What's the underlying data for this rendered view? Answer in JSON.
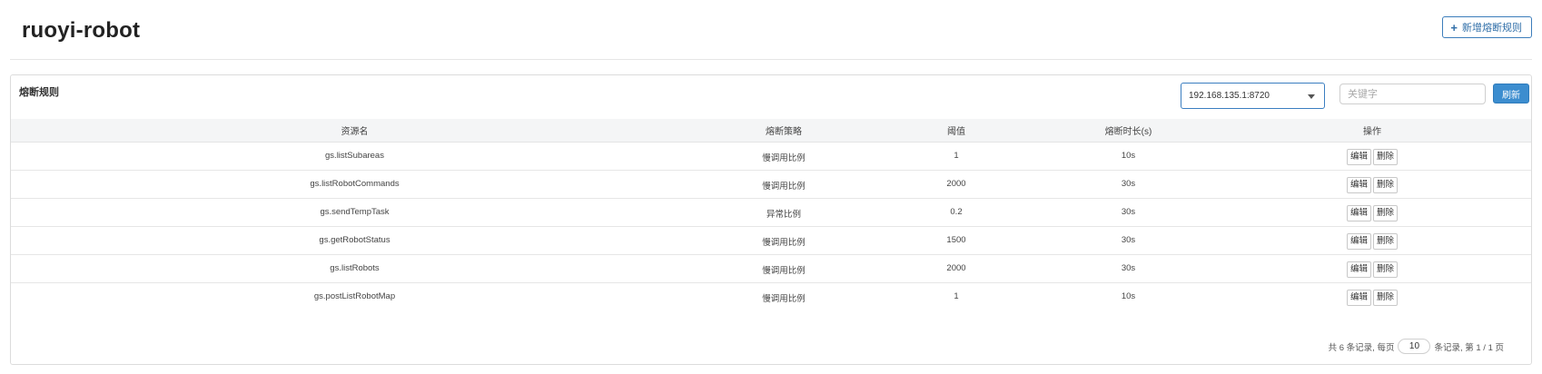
{
  "header": {
    "app_title": "ruoyi-robot",
    "add_button_label": "新增熔断规则"
  },
  "panel": {
    "title": "熔断规则",
    "machine_select": {
      "selected": "192.168.135.1:8720"
    },
    "search": {
      "placeholder": "关键字",
      "value": ""
    },
    "refresh_label": "刷新"
  },
  "table": {
    "columns": [
      "资源名",
      "熔断策略",
      "阈值",
      "熔断时长(s)",
      "操作"
    ],
    "rows": [
      {
        "resource": "gs.listSubareas",
        "strategy": "慢调用比例",
        "threshold": "1",
        "duration": "10s"
      },
      {
        "resource": "gs.listRobotCommands",
        "strategy": "慢调用比例",
        "threshold": "2000",
        "duration": "30s"
      },
      {
        "resource": "gs.sendTempTask",
        "strategy": "异常比例",
        "threshold": "0.2",
        "duration": "30s"
      },
      {
        "resource": "gs.getRobotStatus",
        "strategy": "慢调用比例",
        "threshold": "1500",
        "duration": "30s"
      },
      {
        "resource": "gs.listRobots",
        "strategy": "慢调用比例",
        "threshold": "2000",
        "duration": "30s"
      },
      {
        "resource": "gs.postListRobotMap",
        "strategy": "慢调用比例",
        "threshold": "1",
        "duration": "10s"
      }
    ],
    "edit_label": "编辑",
    "delete_label": "删除"
  },
  "pagination": {
    "prefix": "共 6 条记录, 每页",
    "page_size": "10",
    "suffix": "条记录, 第 1 / 1 页"
  },
  "icons": {
    "add": "plus-icon",
    "select_caret": "chevron-down-icon"
  },
  "colors": {
    "primary": "#3c8dcf",
    "outline_primary": "#3c7dbb"
  }
}
